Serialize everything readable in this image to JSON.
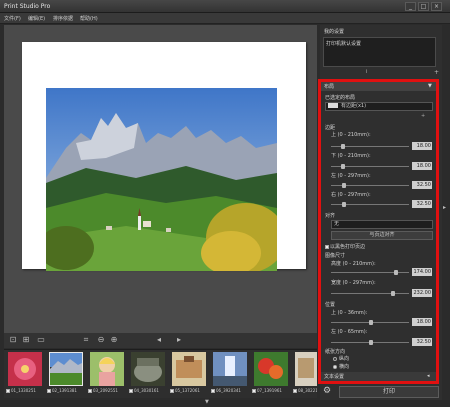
{
  "window": {
    "title": "Print Studio Pro",
    "min": "_",
    "max": "□",
    "close": "×"
  },
  "menu": [
    "文件(F)",
    "编辑(E)",
    "排序依据",
    "帮助(H)"
  ],
  "right_panel": {
    "my_settings_label": "我的设置",
    "my_settings_value": "打印机默认设置",
    "info_icon": "i",
    "add_icon": "+"
  },
  "layout": {
    "header": "布局",
    "selected_layout_label": "已选定的布局",
    "selected_layout_value": "有边距(x1)",
    "margins_label": "边距",
    "margins": [
      {
        "label": "上 (0 - 210mm):",
        "value": "18.00",
        "knob": 0.04
      },
      {
        "label": "下 (0 - 210mm):",
        "value": "18.00",
        "knob": 0.04
      },
      {
        "label": "左 (0 - 297mm):",
        "value": "32.50",
        "knob": 0.06
      },
      {
        "label": "右 (0 - 297mm):",
        "value": "32.50",
        "knob": 0.06
      }
    ],
    "align_label": "对齐",
    "align_value": "无",
    "align_button": "与页边对齐",
    "black_margin_label": "以黑色打印页边",
    "image_size_label": "图像尺寸",
    "image_size": [
      {
        "label": "高度 (0 - 210mm):",
        "value": "174.00",
        "knob": 0.82
      },
      {
        "label": "宽度 (0 - 297mm):",
        "value": "232.00",
        "knob": 0.79
      }
    ],
    "position_label": "位置",
    "position": [
      {
        "label": "上 (0 - 36mm):",
        "value": "18.00",
        "knob": 0.5
      },
      {
        "label": "左 (0 - 65mm):",
        "value": "32.50",
        "knob": 0.5
      }
    ],
    "orientation_label": "纸张方向",
    "orientation_options": [
      "纵向",
      "横向"
    ],
    "orientation_selected": 1,
    "text_settings": "文本设置",
    "print_button": "打印"
  },
  "thumbnails": [
    {
      "label": "01_1330251",
      "checked": true
    },
    {
      "label": "02_1391381",
      "checked": true
    },
    {
      "label": "03_2092551",
      "checked": true
    },
    {
      "label": "04_3030161",
      "checked": true
    },
    {
      "label": "05_1372061",
      "checked": true
    },
    {
      "label": "06_3920341",
      "checked": true
    },
    {
      "label": "07_1391961",
      "checked": true
    },
    {
      "label": "08_3022161",
      "checked": true
    }
  ],
  "toolbar_icons": [
    "fit-to-window-icon",
    "actual-size-icon",
    "display-mode-icon",
    "crop-icon",
    "zoom-out-icon",
    "zoom-in-icon",
    "prev-page-icon",
    "next-page-icon"
  ]
}
